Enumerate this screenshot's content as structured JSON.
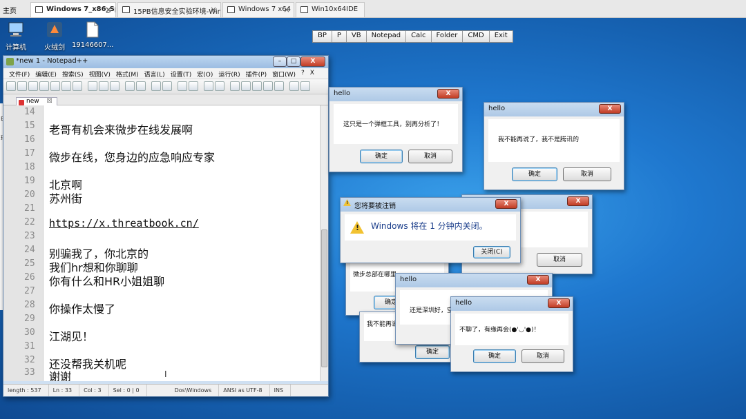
{
  "host_tabs": {
    "home": "主页",
    "tabs": [
      {
        "label": "Windows 7_x86_Sp1",
        "active": true
      },
      {
        "label": "15PB信息安全实验环境-Win...",
        "active": false
      },
      {
        "label": "Windows 7 x64",
        "active": false
      },
      {
        "label": "Win10x64IDE",
        "active": false
      }
    ]
  },
  "desktop_icons": [
    {
      "label": "计算机",
      "icon": "computer-icon"
    },
    {
      "label": "火绒剑",
      "icon": "tool-icon"
    },
    {
      "label": "19146607...",
      "icon": "file-icon"
    }
  ],
  "vm_toolbar": [
    "BP",
    "P",
    "VB",
    "Notepad",
    "Calc",
    "Folder",
    "CMD",
    "Exit"
  ],
  "left_window": {
    "fragments": [
      "En",
      "环境"
    ]
  },
  "notepad": {
    "title": "*new 1 - Notepad++",
    "controls": {
      "min": "–",
      "max": "□",
      "close": "X"
    },
    "menus": [
      "文件(F)",
      "编辑(E)",
      "搜索(S)",
      "视图(V)",
      "格式(M)",
      "语言(L)",
      "设置(T)",
      "宏(O)",
      "运行(R)",
      "插件(P)",
      "窗口(W)",
      "?",
      "X"
    ],
    "doc_tab": "new",
    "doc_tab_close": "☒",
    "lines": [
      {
        "num": "14",
        "text": ""
      },
      {
        "num": "15",
        "text": "老哥有机会来微步在线发展啊"
      },
      {
        "num": "16",
        "text": ""
      },
      {
        "num": "17",
        "text": "微步在线，您身边的应急响应专家"
      },
      {
        "num": "18",
        "text": ""
      },
      {
        "num": "19",
        "text": "北京啊"
      },
      {
        "num": "20",
        "text": "苏州街"
      },
      {
        "num": "21",
        "text": ""
      },
      {
        "num": "22",
        "text": "https://x.threatbook.cn/"
      },
      {
        "num": "23",
        "text": ""
      },
      {
        "num": "24",
        "text": "别骗我了，你北京的"
      },
      {
        "num": "25",
        "text": "我们hr想和你聊聊"
      },
      {
        "num": "26",
        "text": "你有什么和HR小姐姐聊"
      },
      {
        "num": "27",
        "text": ""
      },
      {
        "num": "28",
        "text": "你操作太慢了"
      },
      {
        "num": "29",
        "text": ""
      },
      {
        "num": "30",
        "text": "江湖见！"
      },
      {
        "num": "31",
        "text": ""
      },
      {
        "num": "32",
        "text": "还没帮我关机呢"
      },
      {
        "num": "33",
        "text": "谢谢"
      }
    ],
    "status": [
      "length : 537",
      "Ln : 33",
      "Col : 3",
      "Sel : 0 | 0",
      "Dos\\Windows",
      "ANSI as UTF-8",
      "INS"
    ]
  },
  "dialogs": [
    {
      "id": "hello-1",
      "title": "hello",
      "message": "这只是一个弹框工具，别再分析了！",
      "ok": "确定",
      "cancel": "取消"
    },
    {
      "id": "hello-2",
      "title": "hello",
      "message": "我不能再说了，我不是腾讯的",
      "ok": "确定",
      "cancel": "取消"
    },
    {
      "id": "hello-3",
      "title": "hello",
      "message": "",
      "ok": "",
      "cancel": "取消"
    },
    {
      "id": "logoff",
      "title": "您将要被注销",
      "message": "Windows 将在 1 分钟内关闭。",
      "close": "关闭(C)"
    },
    {
      "id": "hello-4",
      "title": "",
      "message": "微步总部在哪里",
      "ok": "确定",
      "cancel": ""
    },
    {
      "id": "hello-5",
      "title": "hello",
      "message": "还是深圳好，空气",
      "ok": "",
      "cancel": ""
    },
    {
      "id": "hello-6",
      "title": "",
      "message": "我不能再说",
      "ok": "确定",
      "cancel": ""
    },
    {
      "id": "hello-7",
      "title": "hello",
      "message": "不聊了，有缘再会(●'◡'●)！",
      "ok": "确定",
      "cancel": "取消"
    }
  ],
  "dialog_close_glyph": "X"
}
